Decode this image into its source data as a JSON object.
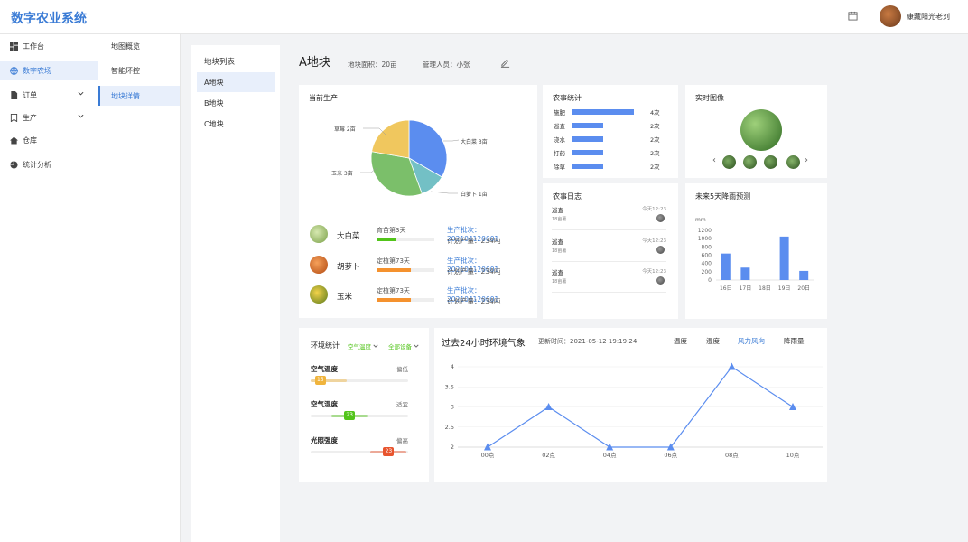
{
  "app": {
    "title": "数字农业系统",
    "user_name": "康藏阳光老刘"
  },
  "sidebar": {
    "items": [
      {
        "label": "工作台",
        "icon": "dashboard-icon"
      },
      {
        "label": "数字农场",
        "icon": "globe-icon",
        "active": true
      },
      {
        "label": "订单",
        "icon": "document-icon"
      },
      {
        "label": "生产",
        "icon": "bookmark-icon"
      },
      {
        "label": "仓库",
        "icon": "home-icon"
      },
      {
        "label": "统计分析",
        "icon": "pie-icon"
      }
    ]
  },
  "subnav": {
    "items": [
      {
        "label": "地图概览"
      },
      {
        "label": "智能环控"
      },
      {
        "label": "地块详情",
        "active": true
      }
    ]
  },
  "plot_list": {
    "title": "地块列表",
    "items": [
      "A地块",
      "B地块",
      "C地块"
    ]
  },
  "plot_header": {
    "title": "A地块",
    "area": "地块面积：20亩",
    "manager": "管理人员：小张"
  },
  "production": {
    "title": "当前生产",
    "pie_labels": [
      "草莓 2亩",
      "大白菜 3亩",
      "玉米 3亩",
      "白萝卜 1亩"
    ],
    "pie": [
      {
        "name": "大白菜",
        "value": 3,
        "color": "#5b8def"
      },
      {
        "name": "白萝卜",
        "value": 1,
        "color": "#73c0c5"
      },
      {
        "name": "玉米",
        "value": 3,
        "color": "#7bbf6a"
      },
      {
        "name": "草莓",
        "value": 2,
        "color": "#f0c75e"
      }
    ],
    "crops": [
      {
        "name": "大白菜",
        "stage": "育苗第3天",
        "progress": 0.35,
        "color": "#52c41a",
        "batch": "生产批次：202104120001",
        "yield": "计划产量：234吨"
      },
      {
        "name": "胡萝卜",
        "stage": "定植第73天",
        "progress": 0.6,
        "color": "#f5922e",
        "batch": "生产批次：202104120001",
        "yield": "计划产量：234吨"
      },
      {
        "name": "玉米",
        "stage": "定植第73天",
        "progress": 0.6,
        "color": "#f5922e",
        "batch": "生产批次：202104120001",
        "yield": "计划产量：234吨"
      }
    ]
  },
  "farm_stats": {
    "title": "农事统计",
    "items": [
      {
        "label": "施肥",
        "count": "4次",
        "value": 4
      },
      {
        "label": "巡查",
        "count": "2次",
        "value": 2
      },
      {
        "label": "浇水",
        "count": "2次",
        "value": 2
      },
      {
        "label": "打药",
        "count": "2次",
        "value": 2
      },
      {
        "label": "除草",
        "count": "2次",
        "value": 2
      }
    ]
  },
  "farm_log": {
    "title": "农事日志",
    "items": [
      {
        "title": "巡查",
        "time": "今天12:23",
        "sub": "18亩薯"
      },
      {
        "title": "巡查",
        "time": "今天12:23",
        "sub": "18亩薯"
      },
      {
        "title": "巡查",
        "time": "今天12:23",
        "sub": "18亩薯"
      }
    ]
  },
  "live_image": {
    "title": "实时图像",
    "prev": "‹",
    "next": "›"
  },
  "rain": {
    "title": "未来5天降雨预测"
  },
  "env": {
    "title": "环境统计",
    "filter1": "空气温度",
    "filter2": "全部设备",
    "items": [
      {
        "label": "空气温度",
        "status": "偏低",
        "value": "15",
        "pos": 0.1,
        "color": "#f0b43c"
      },
      {
        "label": "空气湿度",
        "status": "适宜",
        "value": "23",
        "pos": 0.4,
        "color": "#52c41a"
      },
      {
        "label": "光照强度",
        "status": "偏高",
        "value": "23",
        "pos": 0.8,
        "color": "#e8542e"
      }
    ]
  },
  "weather": {
    "title": "过去24小时环境气象",
    "updated": "更新时间：2021-05-12 19:19:24",
    "tabs": [
      "温度",
      "湿度",
      "风力风向",
      "降雨量"
    ],
    "active_tab": 2
  },
  "chart_data": [
    {
      "type": "pie",
      "title": "",
      "categories": [
        "大白菜",
        "白萝卜",
        "玉米",
        "草莓"
      ],
      "values": [
        3,
        1,
        3,
        2
      ]
    },
    {
      "type": "bar",
      "title": "",
      "ylabel": "mm",
      "categories": [
        "16日",
        "17日",
        "18日",
        "19日",
        "20日"
      ],
      "values": [
        640,
        300,
        0,
        1050,
        220
      ],
      "ylim": [
        0,
        1200
      ],
      "yticks": [
        "1200",
        "1000",
        "800",
        "600",
        "400",
        "200",
        "0"
      ],
      "color": "#5b8def"
    },
    {
      "type": "line",
      "title": "",
      "categories": [
        "00点",
        "02点",
        "04点",
        "06点",
        "08点",
        "10点"
      ],
      "values": [
        2,
        3,
        2,
        2,
        4,
        3
      ],
      "ylim": [
        2,
        4
      ],
      "yticks": [
        "4",
        "3.5",
        "3",
        "2.5",
        "2"
      ],
      "color": "#5b8def"
    }
  ]
}
